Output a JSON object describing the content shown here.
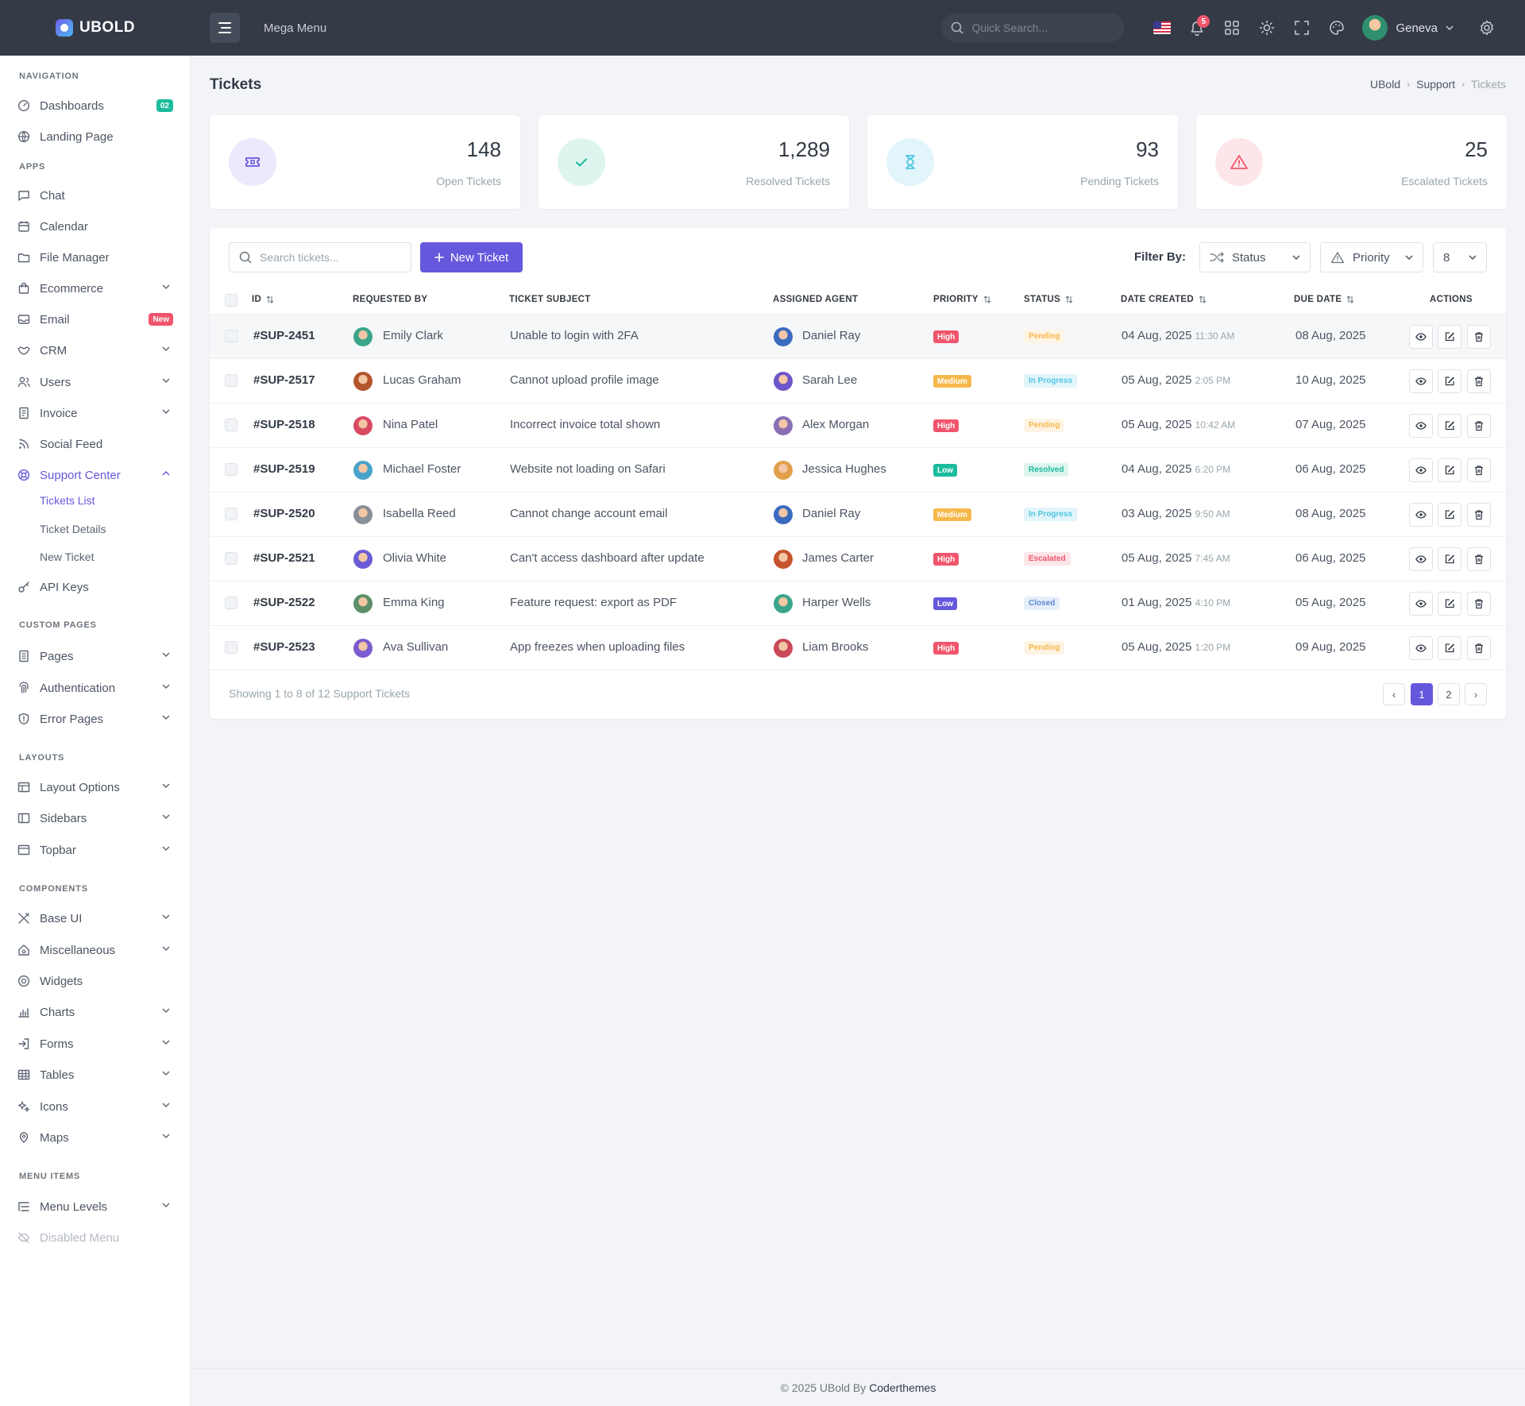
{
  "brand": {
    "name": "UBOLD"
  },
  "topbar": {
    "mega_menu": "Mega Menu",
    "search_placeholder": "Quick Search...",
    "notifications_count": "5",
    "user_name": "Geneva"
  },
  "sidebar": {
    "sections": {
      "navigation": "NAVIGATION",
      "apps": "APPS",
      "custom_pages": "CUSTOM PAGES",
      "layouts": "LAYOUTS",
      "components": "COMPONENTS",
      "menu_items": "MENU ITEMS"
    },
    "items": {
      "dashboards": {
        "label": "Dashboards",
        "badge": "02"
      },
      "landing": {
        "label": "Landing Page"
      },
      "chat": {
        "label": "Chat"
      },
      "calendar": {
        "label": "Calendar"
      },
      "file_manager": {
        "label": "File Manager"
      },
      "ecommerce": {
        "label": "Ecommerce"
      },
      "email": {
        "label": "Email",
        "badge": "New"
      },
      "crm": {
        "label": "CRM"
      },
      "users": {
        "label": "Users"
      },
      "invoice": {
        "label": "Invoice"
      },
      "social_feed": {
        "label": "Social Feed"
      },
      "support_center": {
        "label": "Support Center"
      },
      "tickets_list": {
        "label": "Tickets List"
      },
      "ticket_details": {
        "label": "Ticket Details"
      },
      "new_ticket": {
        "label": "New Ticket"
      },
      "api_keys": {
        "label": "API Keys"
      },
      "pages": {
        "label": "Pages"
      },
      "authentication": {
        "label": "Authentication"
      },
      "error_pages": {
        "label": "Error Pages"
      },
      "layout_options": {
        "label": "Layout Options"
      },
      "sidebars": {
        "label": "Sidebars"
      },
      "topbar": {
        "label": "Topbar"
      },
      "base_ui": {
        "label": "Base UI"
      },
      "misc": {
        "label": "Miscellaneous"
      },
      "widgets": {
        "label": "Widgets"
      },
      "charts": {
        "label": "Charts"
      },
      "forms": {
        "label": "Forms"
      },
      "tables": {
        "label": "Tables"
      },
      "icons": {
        "label": "Icons"
      },
      "maps": {
        "label": "Maps"
      },
      "menu_levels": {
        "label": "Menu Levels"
      },
      "disabled_menu": {
        "label": "Disabled Menu"
      }
    }
  },
  "page": {
    "title": "Tickets",
    "breadcrumb": [
      "UBold",
      "Support",
      "Tickets"
    ]
  },
  "stats": [
    {
      "value": "148",
      "label": "Open Tickets",
      "icon": "ticket-icon",
      "color": "#6658dd"
    },
    {
      "value": "1,289",
      "label": "Resolved Tickets",
      "icon": "check-icon",
      "color": "#1abc9c"
    },
    {
      "value": "93",
      "label": "Pending Tickets",
      "icon": "hourglass-icon",
      "color": "#4fc6e1"
    },
    {
      "value": "25",
      "label": "Escalated Tickets",
      "icon": "alert-triangle-icon",
      "color": "#f1556c"
    }
  ],
  "toolbar": {
    "search_placeholder": "Search tickets...",
    "new_ticket": "New Ticket",
    "filter_by": "Filter By:",
    "status": "Status",
    "priority": "Priority",
    "page_size": "8"
  },
  "table": {
    "headers": {
      "id": "ID",
      "requested_by": "REQUESTED BY",
      "subject": "TICKET SUBJECT",
      "agent": "ASSIGNED AGENT",
      "priority": "PRIORITY",
      "status": "STATUS",
      "created": "DATE CREATED",
      "due": "DUE DATE",
      "actions": "ACTIONS"
    },
    "rows": [
      {
        "id": "#SUP-2451",
        "requester": "Emily Clark",
        "subject": "Unable to login with 2FA",
        "agent": "Daniel Ray",
        "priority": "High",
        "status": "Pending",
        "created_date": "04 Aug, 2025",
        "created_time": "11:30 AM",
        "due": "08 Aug, 2025"
      },
      {
        "id": "#SUP-2517",
        "requester": "Lucas Graham",
        "subject": "Cannot upload profile image",
        "agent": "Sarah Lee",
        "priority": "Medium",
        "status": "In Progress",
        "created_date": "05 Aug, 2025",
        "created_time": "2:05 PM",
        "due": "10 Aug, 2025"
      },
      {
        "id": "#SUP-2518",
        "requester": "Nina Patel",
        "subject": "Incorrect invoice total shown",
        "agent": "Alex Morgan",
        "priority": "High",
        "status": "Pending",
        "created_date": "05 Aug, 2025",
        "created_time": "10:42 AM",
        "due": "07 Aug, 2025"
      },
      {
        "id": "#SUP-2519",
        "requester": "Michael Foster",
        "subject": "Website not loading on Safari",
        "agent": "Jessica Hughes",
        "priority": "Low",
        "status": "Resolved",
        "created_date": "04 Aug, 2025",
        "created_time": "6:20 PM",
        "due": "06 Aug, 2025"
      },
      {
        "id": "#SUP-2520",
        "requester": "Isabella Reed",
        "subject": "Cannot change account email",
        "agent": "Daniel Ray",
        "priority": "Medium",
        "status": "In Progress",
        "created_date": "03 Aug, 2025",
        "created_time": "9:50 AM",
        "due": "08 Aug, 2025"
      },
      {
        "id": "#SUP-2521",
        "requester": "Olivia White",
        "subject": "Can't access dashboard after update",
        "agent": "James Carter",
        "priority": "High",
        "status": "Escalated",
        "created_date": "05 Aug, 2025",
        "created_time": "7:45 AM",
        "due": "06 Aug, 2025"
      },
      {
        "id": "#SUP-2522",
        "requester": "Emma King",
        "subject": "Feature request: export as PDF",
        "agent": "Harper Wells",
        "priority": "Low",
        "status": "Closed",
        "created_date": "01 Aug, 2025",
        "created_time": "4:10 PM",
        "due": "05 Aug, 2025"
      },
      {
        "id": "#SUP-2523",
        "requester": "Ava Sullivan",
        "subject": "App freezes when uploading files",
        "agent": "Liam Brooks",
        "priority": "High",
        "status": "Pending",
        "created_date": "05 Aug, 2025",
        "created_time": "1:20 PM",
        "due": "09 Aug, 2025"
      }
    ]
  },
  "pagination": {
    "showing": "Showing 1 to 8 of 12 Support Tickets",
    "pages": [
      "1",
      "2"
    ],
    "prev": "‹",
    "next": "›"
  },
  "footer": {
    "text": "© 2025 UBold By",
    "brand": "Coderthemes"
  }
}
